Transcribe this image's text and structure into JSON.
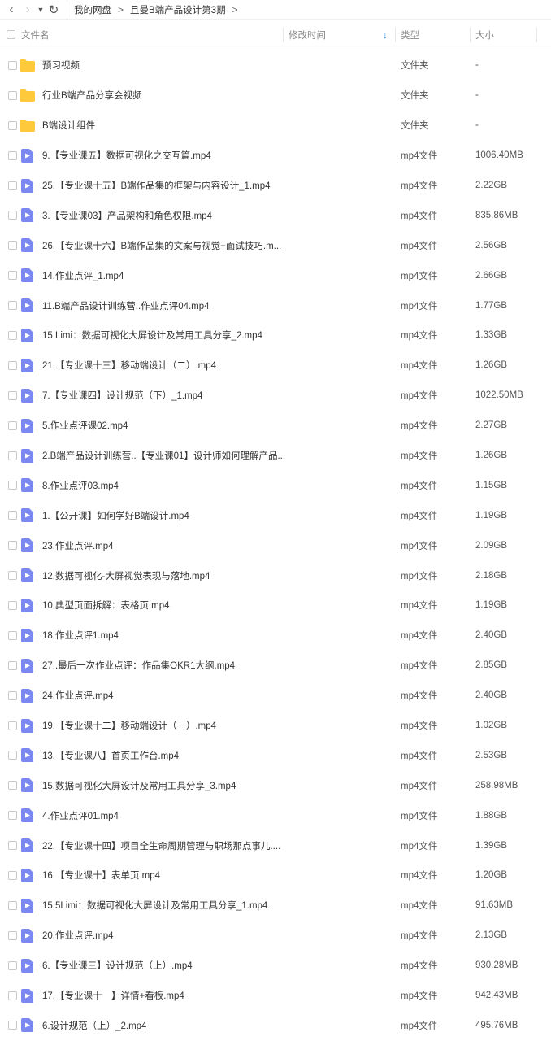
{
  "toolbar": {
    "back_icon": "chevron-left",
    "forward_icon": "chevron-right",
    "history_dropdown_icon": "caret-down",
    "refresh_icon": "refresh",
    "breadcrumbs": [
      "我的网盘",
      "且曼B端产品设计第3期"
    ],
    "breadcrumb_separator": ">"
  },
  "columns": {
    "name": "文件名",
    "mtime": "修改时间",
    "type": "类型",
    "size": "大小",
    "sort_icon": "arrow-down"
  },
  "colors": {
    "folder": "#ffc93c",
    "video": "#7b88f2",
    "sort_accent": "#3a8ee6"
  },
  "files": [
    {
      "name": "预习视频",
      "type": "文件夹",
      "size": "-",
      "kind": "folder"
    },
    {
      "name": "行业B端产品分享会视频",
      "type": "文件夹",
      "size": "-",
      "kind": "folder"
    },
    {
      "name": "B端设计组件",
      "type": "文件夹",
      "size": "-",
      "kind": "folder"
    },
    {
      "name": "9.【专业课五】数据可视化之交互篇.mp4",
      "type": "mp4文件",
      "size": "1006.40MB",
      "kind": "video"
    },
    {
      "name": "25.【专业课十五】B端作品集的框架与内容设计_1.mp4",
      "type": "mp4文件",
      "size": "2.22GB",
      "kind": "video"
    },
    {
      "name": "3.【专业课03】产品架构和角色权限.mp4",
      "type": "mp4文件",
      "size": "835.86MB",
      "kind": "video"
    },
    {
      "name": "26.【专业课十六】B端作品集的文案与视觉+面试技巧.m...",
      "type": "mp4文件",
      "size": "2.56GB",
      "kind": "video"
    },
    {
      "name": "14.作业点评_1.mp4",
      "type": "mp4文件",
      "size": "2.66GB",
      "kind": "video"
    },
    {
      "name": "11.B端产品设计训练营..作业点评04.mp4",
      "type": "mp4文件",
      "size": "1.77GB",
      "kind": "video"
    },
    {
      "name": "15.Limi：数据可视化大屏设计及常用工具分享_2.mp4",
      "type": "mp4文件",
      "size": "1.33GB",
      "kind": "video"
    },
    {
      "name": "21.【专业课十三】移动端设计（二）.mp4",
      "type": "mp4文件",
      "size": "1.26GB",
      "kind": "video"
    },
    {
      "name": "7.【专业课四】设计规范（下）_1.mp4",
      "type": "mp4文件",
      "size": "1022.50MB",
      "kind": "video"
    },
    {
      "name": "5.作业点评课02.mp4",
      "type": "mp4文件",
      "size": "2.27GB",
      "kind": "video"
    },
    {
      "name": "2.B端产品设计训练营..【专业课01】设计师如何理解产品...",
      "type": "mp4文件",
      "size": "1.26GB",
      "kind": "video"
    },
    {
      "name": "8.作业点评03.mp4",
      "type": "mp4文件",
      "size": "1.15GB",
      "kind": "video"
    },
    {
      "name": "1.【公开课】如何学好B端设计.mp4",
      "type": "mp4文件",
      "size": "1.19GB",
      "kind": "video"
    },
    {
      "name": "23.作业点评.mp4",
      "type": "mp4文件",
      "size": "2.09GB",
      "kind": "video"
    },
    {
      "name": "12.数据可视化-大屏视觉表现与落地.mp4",
      "type": "mp4文件",
      "size": "2.18GB",
      "kind": "video"
    },
    {
      "name": "10.典型页面拆解：表格页.mp4",
      "type": "mp4文件",
      "size": "1.19GB",
      "kind": "video"
    },
    {
      "name": "18.作业点评1.mp4",
      "type": "mp4文件",
      "size": "2.40GB",
      "kind": "video"
    },
    {
      "name": "27..最后一次作业点评：作品集OKR1大纲.mp4",
      "type": "mp4文件",
      "size": "2.85GB",
      "kind": "video"
    },
    {
      "name": "24.作业点评.mp4",
      "type": "mp4文件",
      "size": "2.40GB",
      "kind": "video"
    },
    {
      "name": "19.【专业课十二】移动端设计（一）.mp4",
      "type": "mp4文件",
      "size": "1.02GB",
      "kind": "video"
    },
    {
      "name": "13.【专业课八】首页工作台.mp4",
      "type": "mp4文件",
      "size": "2.53GB",
      "kind": "video"
    },
    {
      "name": "15.数据可视化大屏设计及常用工具分享_3.mp4",
      "type": "mp4文件",
      "size": "258.98MB",
      "kind": "video"
    },
    {
      "name": "4.作业点评01.mp4",
      "type": "mp4文件",
      "size": "1.88GB",
      "kind": "video"
    },
    {
      "name": "22.【专业课十四】项目全生命周期管理与职场那点事儿....",
      "type": "mp4文件",
      "size": "1.39GB",
      "kind": "video"
    },
    {
      "name": "16.【专业课十】表单页.mp4",
      "type": "mp4文件",
      "size": "1.20GB",
      "kind": "video"
    },
    {
      "name": "15.5Limi：数据可视化大屏设计及常用工具分享_1.mp4",
      "type": "mp4文件",
      "size": "91.63MB",
      "kind": "video"
    },
    {
      "name": "20.作业点评.mp4",
      "type": "mp4文件",
      "size": "2.13GB",
      "kind": "video"
    },
    {
      "name": "6.【专业课三】设计规范（上）.mp4",
      "type": "mp4文件",
      "size": "930.28MB",
      "kind": "video"
    },
    {
      "name": "17.【专业课十一】详情+看板.mp4",
      "type": "mp4文件",
      "size": "942.43MB",
      "kind": "video"
    },
    {
      "name": "6.设计规范（上）_2.mp4",
      "type": "mp4文件",
      "size": "495.76MB",
      "kind": "video"
    }
  ]
}
